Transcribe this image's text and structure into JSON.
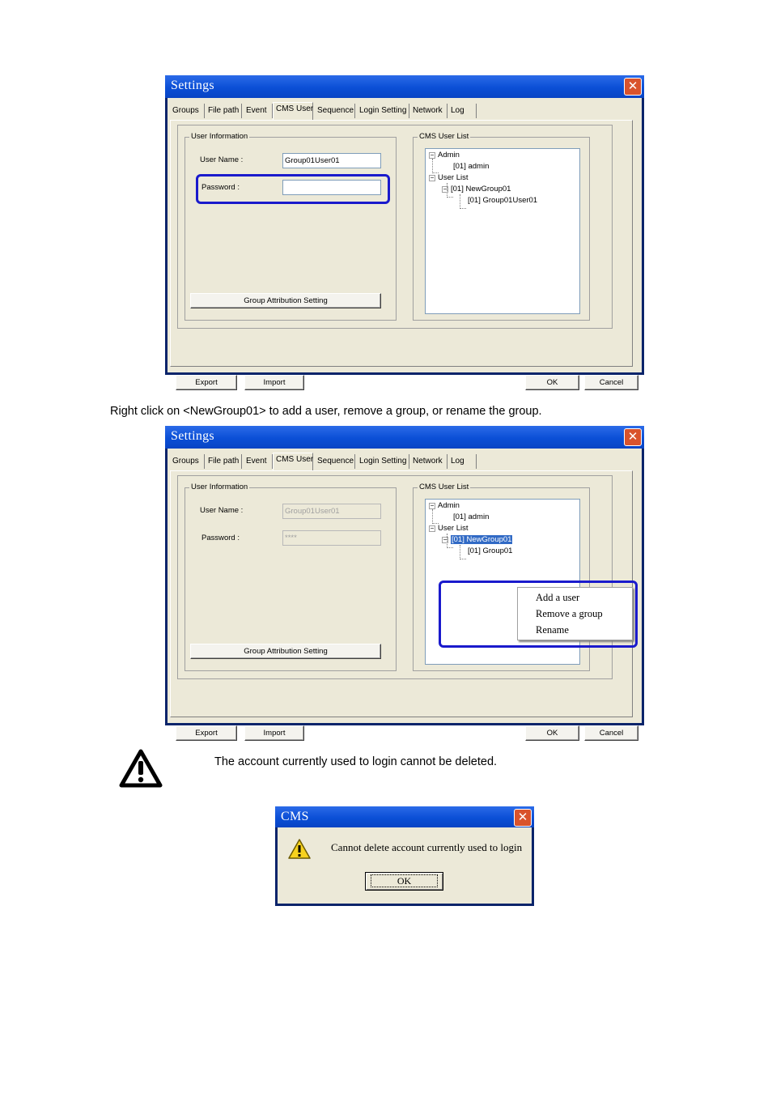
{
  "settings_window_1": {
    "title": "Settings",
    "close_label": "✕",
    "tabs": [
      "Groups",
      "File path",
      "Event",
      "CMS User",
      "Sequence",
      "Login Setting",
      "Network",
      "Log"
    ],
    "active_tab": "CMS User",
    "user_info": {
      "legend": "User Information",
      "user_name_label": "User Name :",
      "user_name_value": "Group01User01",
      "password_label": "Password :",
      "password_value": "",
      "group_button": "Group Attribution Setting"
    },
    "user_list": {
      "legend": "CMS User List",
      "admin": "Admin",
      "admin_child": "[01] admin",
      "user_list": "User List",
      "group": "[01] NewGroup01",
      "group_child": "[01] Group01User01"
    },
    "buttons": {
      "export": "Export",
      "import": "Import",
      "ok": "OK",
      "cancel": "Cancel"
    }
  },
  "instruction_text": "Right click on <NewGroup01> to add a user, remove a group, or rename the group.",
  "settings_window_2": {
    "title": "Settings",
    "close_label": "✕",
    "tabs": [
      "Groups",
      "File path",
      "Event",
      "CMS User",
      "Sequence",
      "Login Setting",
      "Network",
      "Log"
    ],
    "user_info": {
      "legend": "User Information",
      "user_name_label": "User Name :",
      "user_name_value": "Group01User01",
      "password_label": "Password :",
      "password_value": "****",
      "group_button": "Group Attribution Setting"
    },
    "user_list": {
      "legend": "CMS User List",
      "admin": "Admin",
      "admin_child": "[01] admin",
      "user_list": "User List",
      "group": "[01] NewGroup01",
      "group_child": "[01] Group01"
    },
    "context_menu": [
      "Add a user",
      "Remove a group",
      "Rename"
    ],
    "buttons": {
      "export": "Export",
      "import": "Import",
      "ok": "OK",
      "cancel": "Cancel"
    }
  },
  "warning_note": "The account currently used to login cannot be deleted.",
  "cms_dialog": {
    "title": "CMS",
    "close_label": "✕",
    "message": "Cannot delete account currently used to login",
    "ok_label": "OK"
  },
  "colors": {
    "title_bar": "#0b4fd6",
    "highlight": "#1a1acc",
    "selection": "#316ac5",
    "close_button": "#d9532c"
  }
}
